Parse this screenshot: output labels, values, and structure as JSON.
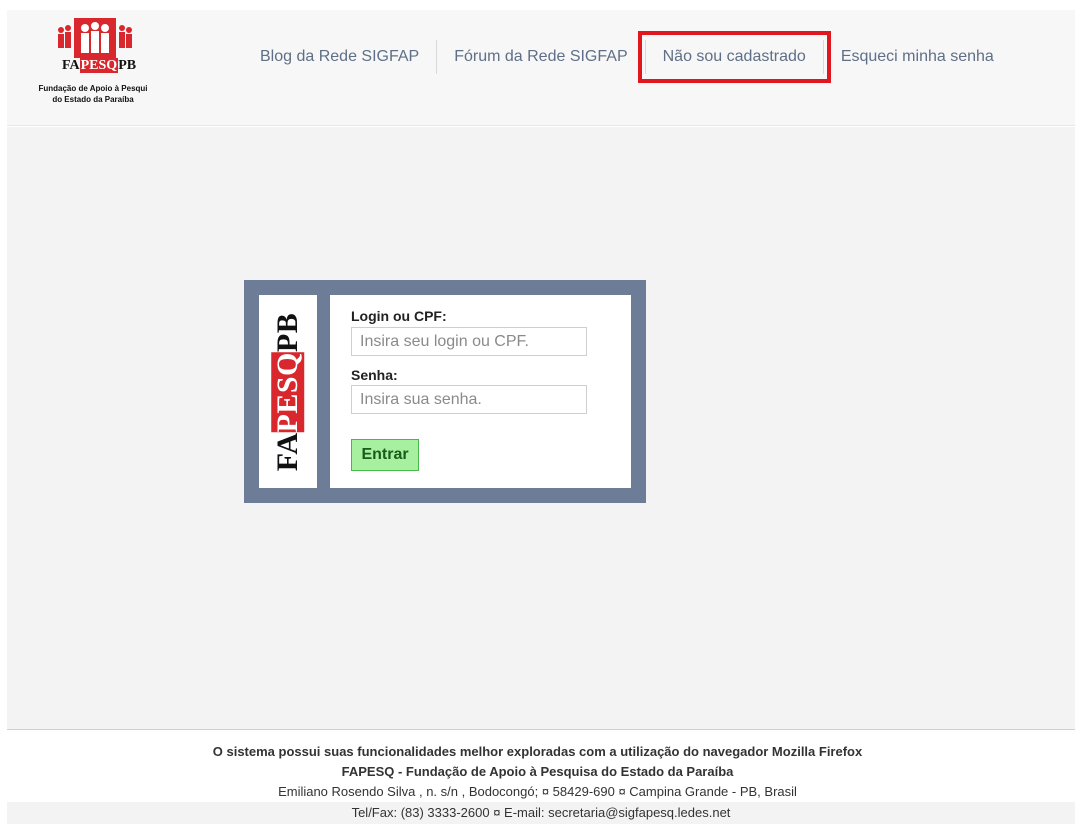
{
  "header": {
    "logo": {
      "text_left": "FA",
      "text_red": "PESQ",
      "text_right": "PB",
      "caption_line1": "Fundação de Apoio à Pesqui",
      "caption_line2": "do Estado da Paraíba"
    },
    "nav": [
      {
        "label": "Blog da Rede SIGFAP"
      },
      {
        "label": "Fórum da Rede SIGFAP"
      },
      {
        "label": "Não sou cadastrado",
        "highlighted": true
      },
      {
        "label": "Esqueci minha senha"
      }
    ],
    "highlight_color": "#e0171e"
  },
  "login": {
    "side_logo": {
      "text_left": "FA",
      "text_red": "PESQ",
      "text_right": "PB"
    },
    "login_label": "Login ou CPF:",
    "login_placeholder": "Insira seu login ou CPF.",
    "login_value": "",
    "password_label": "Senha:",
    "password_placeholder": "Insira sua senha.",
    "password_value": "",
    "submit_label": "Entrar"
  },
  "footer": {
    "line1": "O sistema possui suas funcionalidades melhor exploradas com a utilização do navegador Mozilla Firefox",
    "line2": "FAPESQ - Fundação de Apoio à Pesquisa do Estado da Paraíba",
    "line3": "Emiliano Rosendo Silva , n. s/n , Bodocongó; ¤ 58429-690 ¤ Campina Grande - PB, Brasil",
    "line4": "Tel/Fax: (83) 3333-2600 ¤ E-mail: secretaria@sigfapesq.ledes.net"
  },
  "colors": {
    "card_border": "#6e7d97",
    "nav_text": "#5e6f87",
    "logo_red": "#d9272e",
    "submit_bg": "#a6f0a0",
    "submit_border": "#49b84a"
  }
}
